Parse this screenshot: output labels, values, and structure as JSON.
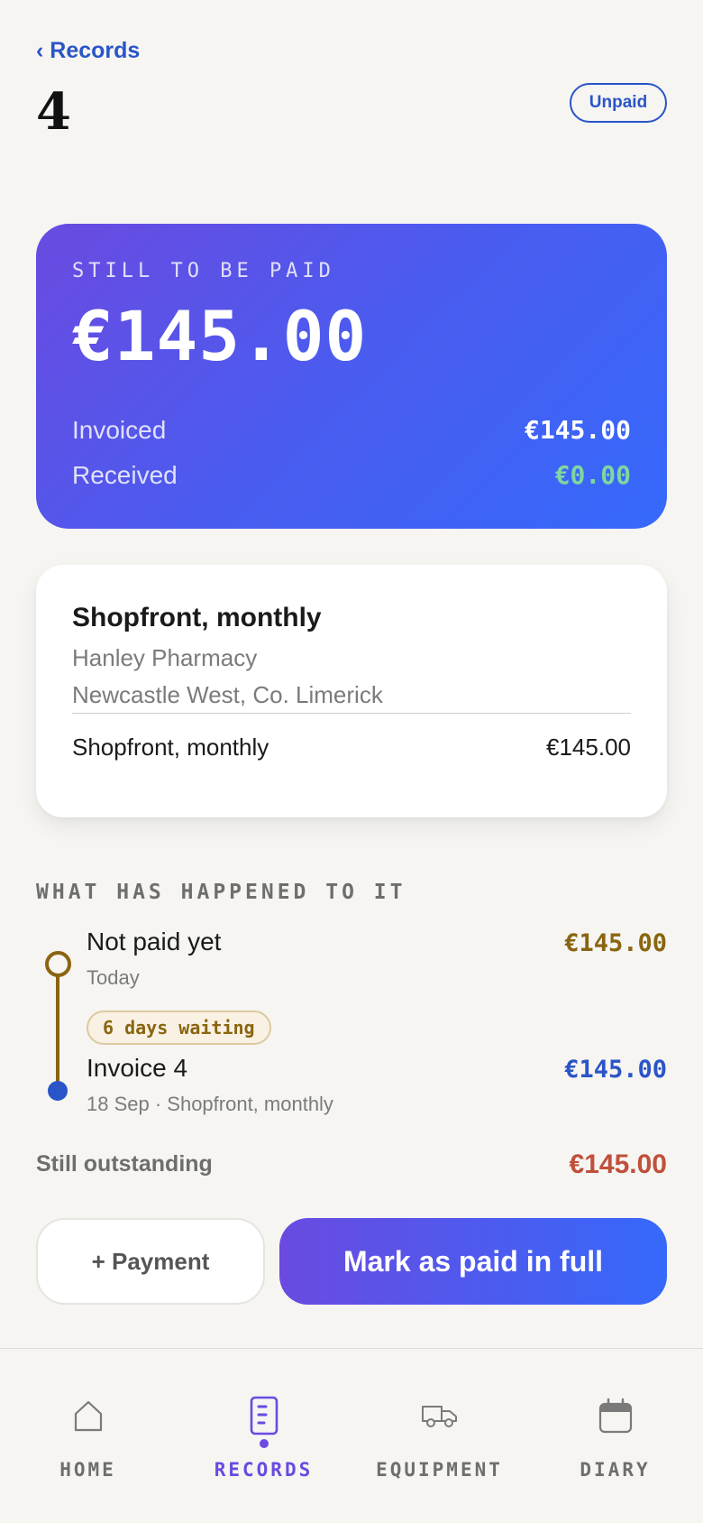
{
  "header": {
    "back_label": "‹ Records",
    "title": "4",
    "status": "Unpaid"
  },
  "balance": {
    "label": "STILL TO BE PAID",
    "amount": "€145.00",
    "invoiced_label": "Invoiced",
    "invoiced_value": "€145.00",
    "received_label": "Received",
    "received_value": "€0.00"
  },
  "detail": {
    "title": "Shopfront, monthly",
    "client": "Hanley Pharmacy",
    "location": "Newcastle West, Co. Limerick",
    "line_item_label": "Shopfront, monthly",
    "line_item_value": "€145.00"
  },
  "history": {
    "heading": "WHAT HAS HAPPENED TO IT",
    "events": [
      {
        "title": "Not paid yet",
        "sub": "Today",
        "amount": "€145.00",
        "color": "#8a6510"
      },
      {
        "title": "Invoice 4",
        "sub": "18 Sep · Shopfront, monthly",
        "amount": "€145.00",
        "color": "#2a55c8"
      }
    ],
    "waiting_badge": "6 days waiting"
  },
  "outstanding": {
    "label": "Still outstanding",
    "value": "€145.00"
  },
  "actions": {
    "payment_label": "+ Payment",
    "paid_label": "Mark as paid in full"
  },
  "nav": {
    "items": [
      {
        "label": "HOME",
        "icon": "home-icon",
        "active": false
      },
      {
        "label": "RECORDS",
        "icon": "document-icon",
        "active": true
      },
      {
        "label": "EQUIPMENT",
        "icon": "truck-icon",
        "active": false
      },
      {
        "label": "DIARY",
        "icon": "calendar-icon",
        "active": false
      }
    ]
  },
  "colors": {
    "accent_purple": "#6a4ae0",
    "accent_blue": "#2a55c8",
    "gold": "#8a6510",
    "outstanding_red": "#c0503c",
    "received_green": "#7fd6a0"
  }
}
